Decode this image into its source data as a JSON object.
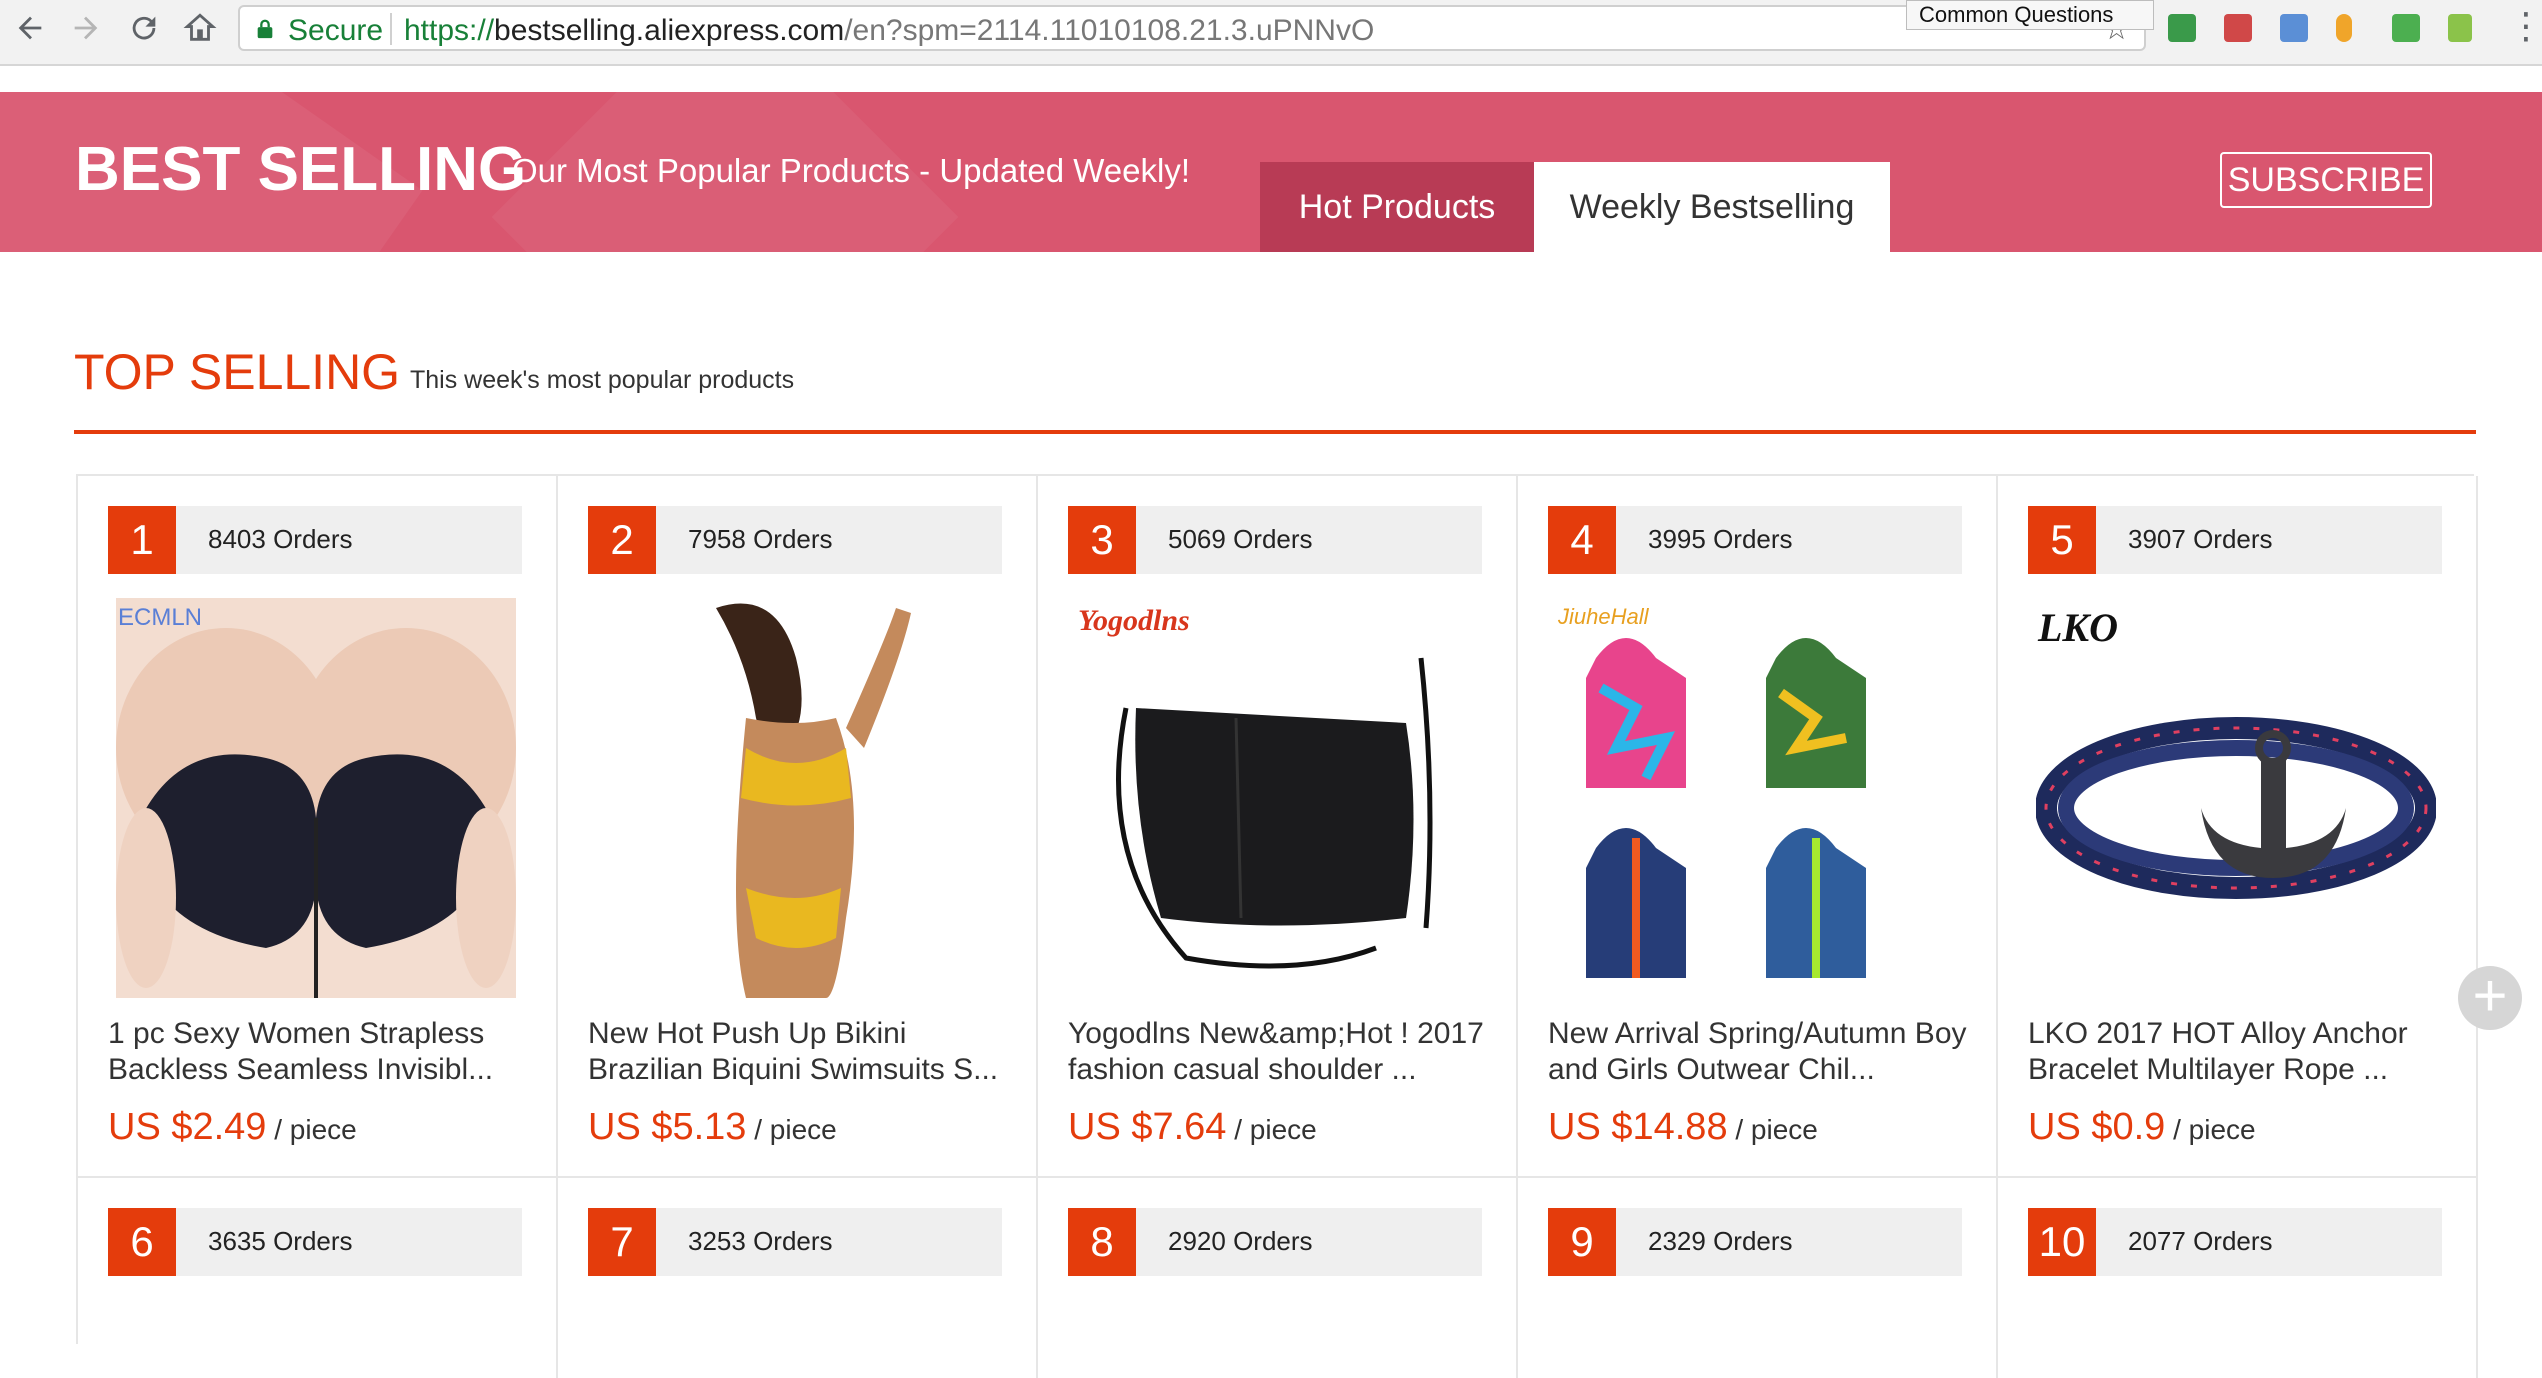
{
  "browser": {
    "secure_label": "Secure",
    "url_scheme": "https://",
    "url_host": "bestselling.aliexpress.com",
    "url_path": "/en?spm=2114.11010108.21.3.uPNNvO",
    "tooltip": "Common Questions"
  },
  "banner": {
    "title": "BEST SELLING",
    "subtitle": "Our Most Popular Products - Updated Weekly!",
    "tabs": [
      {
        "label": "Hot Products",
        "active": false
      },
      {
        "label": "Weekly Bestselling",
        "active": true
      }
    ],
    "subscribe_label": "SUBSCRIBE"
  },
  "section": {
    "title": "TOP SELLING",
    "subtitle": "This week's most popular products"
  },
  "products": [
    {
      "rank": "1",
      "orders": "8403 Orders",
      "brand": "ECMLN",
      "title_line1": "1 pc Sexy Women Strapless",
      "title_line2": "Backless Seamless Invisibl...",
      "price": "US $2.49",
      "unit": "/ piece"
    },
    {
      "rank": "2",
      "orders": "7958 Orders",
      "brand": "",
      "title_line1": "New Hot Push Up Bikini",
      "title_line2": "Brazilian Biquini Swimsuits S...",
      "price": "US $5.13",
      "unit": "/ piece"
    },
    {
      "rank": "3",
      "orders": "5069 Orders",
      "brand": "Yogodlns",
      "title_line1": "Yogodlns New&amp;Hot ! 2017",
      "title_line2": "fashion casual shoulder ...",
      "price": "US $7.64",
      "unit": "/ piece"
    },
    {
      "rank": "4",
      "orders": "3995 Orders",
      "brand": "JiuheHall",
      "title_line1": "New Arrival Spring/Autumn Boy",
      "title_line2": "and Girls Outwear Chil...",
      "price": "US $14.88",
      "unit": "/ piece"
    },
    {
      "rank": "5",
      "orders": "3907 Orders",
      "brand": "LKO",
      "title_line1": "LKO 2017 HOT Alloy Anchor",
      "title_line2": "Bracelet Multilayer Rope ...",
      "price": "US $0.9",
      "unit": "/ piece"
    }
  ],
  "products_row2": [
    {
      "rank": "6",
      "orders": "3635 Orders"
    },
    {
      "rank": "7",
      "orders": "3253 Orders"
    },
    {
      "rank": "8",
      "orders": "2920 Orders"
    },
    {
      "rank": "9",
      "orders": "2329 Orders"
    },
    {
      "rank": "10",
      "orders": "2077 Orders"
    }
  ],
  "colors": {
    "banner": "#d9566f",
    "accent": "#e43c0c",
    "tab_active_bg": "#ffffff",
    "tab_inactive_bg": "#b83b55"
  }
}
